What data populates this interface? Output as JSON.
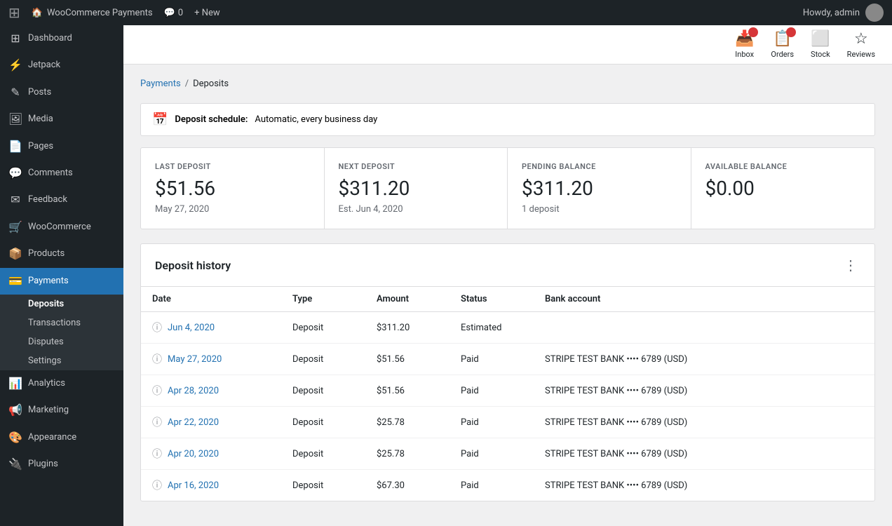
{
  "admin_bar": {
    "logo": "W",
    "site_name": "WooCommerce Payments",
    "comments_label": "Comments",
    "comments_count": "0",
    "new_label": "+ New",
    "howdy": "Howdy, admin"
  },
  "toolbar": {
    "inbox_label": "Inbox",
    "orders_label": "Orders",
    "stock_label": "Stock",
    "reviews_label": "Reviews"
  },
  "sidebar": {
    "items": [
      {
        "id": "dashboard",
        "label": "Dashboard",
        "icon": "⊞"
      },
      {
        "id": "jetpack",
        "label": "Jetpack",
        "icon": "⚡"
      },
      {
        "id": "posts",
        "label": "Posts",
        "icon": "✎"
      },
      {
        "id": "media",
        "label": "Media",
        "icon": "🖼"
      },
      {
        "id": "pages",
        "label": "Pages",
        "icon": "📄"
      },
      {
        "id": "comments",
        "label": "Comments",
        "icon": "💬"
      },
      {
        "id": "feedback",
        "label": "Feedback",
        "icon": "✉"
      },
      {
        "id": "woocommerce",
        "label": "WooCommerce",
        "icon": "🛒"
      },
      {
        "id": "products",
        "label": "Products",
        "icon": "📦"
      },
      {
        "id": "payments",
        "label": "Payments",
        "icon": "💳",
        "active": true
      },
      {
        "id": "analytics",
        "label": "Analytics",
        "icon": "📊"
      },
      {
        "id": "marketing",
        "label": "Marketing",
        "icon": "📢"
      },
      {
        "id": "appearance",
        "label": "Appearance",
        "icon": "🎨"
      },
      {
        "id": "plugins",
        "label": "Plugins",
        "icon": "🔌"
      }
    ],
    "submenu": [
      {
        "id": "deposits",
        "label": "Deposits",
        "active": true
      },
      {
        "id": "transactions",
        "label": "Transactions"
      },
      {
        "id": "disputes",
        "label": "Disputes"
      },
      {
        "id": "settings",
        "label": "Settings"
      }
    ]
  },
  "breadcrumb": {
    "parent_label": "Payments",
    "current_label": "Deposits",
    "separator": "/"
  },
  "deposit_schedule": {
    "label": "Deposit schedule:",
    "value": "Automatic, every business day"
  },
  "stats": [
    {
      "label": "LAST DEPOSIT",
      "value": "$51.56",
      "sub": "May 27, 2020"
    },
    {
      "label": "NEXT DEPOSIT",
      "value": "$311.20",
      "sub": "Est. Jun 4, 2020"
    },
    {
      "label": "PENDING BALANCE",
      "value": "$311.20",
      "sub": "1 deposit"
    },
    {
      "label": "AVAILABLE BALANCE",
      "value": "$0.00",
      "sub": ""
    }
  ],
  "deposit_history": {
    "title": "Deposit history",
    "columns": [
      "Date",
      "Type",
      "Amount",
      "Status",
      "Bank account"
    ],
    "rows": [
      {
        "date": "Jun 4, 2020",
        "type": "Deposit",
        "amount": "$311.20",
        "status": "Estimated",
        "bank": ""
      },
      {
        "date": "May 27, 2020",
        "type": "Deposit",
        "amount": "$51.56",
        "status": "Paid",
        "bank": "STRIPE TEST BANK •••• 6789 (USD)"
      },
      {
        "date": "Apr 28, 2020",
        "type": "Deposit",
        "amount": "$51.56",
        "status": "Paid",
        "bank": "STRIPE TEST BANK •••• 6789 (USD)"
      },
      {
        "date": "Apr 22, 2020",
        "type": "Deposit",
        "amount": "$25.78",
        "status": "Paid",
        "bank": "STRIPE TEST BANK •••• 6789 (USD)"
      },
      {
        "date": "Apr 20, 2020",
        "type": "Deposit",
        "amount": "$25.78",
        "status": "Paid",
        "bank": "STRIPE TEST BANK •••• 6789 (USD)"
      },
      {
        "date": "Apr 16, 2020",
        "type": "Deposit",
        "amount": "$67.30",
        "status": "Paid",
        "bank": "STRIPE TEST BANK •••• 6789 (USD)"
      }
    ]
  }
}
